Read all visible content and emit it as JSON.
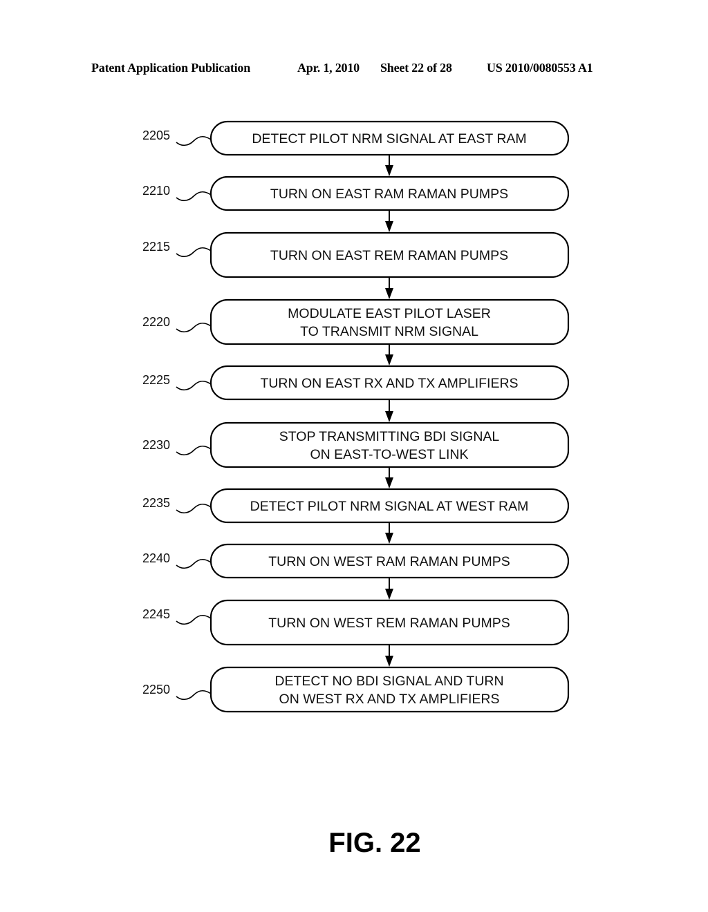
{
  "header": {
    "publication": "Patent Application Publication",
    "date": "Apr. 1, 2010",
    "sheet": "Sheet 22 of 28",
    "number": "US 2010/0080553 A1"
  },
  "steps": [
    {
      "ref": "2205",
      "lines": [
        "DETECT PILOT NRM SIGNAL AT EAST RAM"
      ]
    },
    {
      "ref": "2210",
      "lines": [
        "TURN ON EAST RAM RAMAN PUMPS"
      ]
    },
    {
      "ref": "2215",
      "lines": [
        "TURN ON EAST REM RAMAN PUMPS"
      ]
    },
    {
      "ref": "2220",
      "lines": [
        "MODULATE EAST PILOT LASER",
        "TO TRANSMIT NRM SIGNAL"
      ]
    },
    {
      "ref": "2225",
      "lines": [
        "TURN ON EAST RX AND TX AMPLIFIERS"
      ]
    },
    {
      "ref": "2230",
      "lines": [
        "STOP TRANSMITTING BDI SIGNAL",
        "ON EAST-TO-WEST LINK"
      ]
    },
    {
      "ref": "2235",
      "lines": [
        "DETECT PILOT NRM SIGNAL AT WEST RAM"
      ]
    },
    {
      "ref": "2240",
      "lines": [
        "TURN ON WEST RAM RAMAN PUMPS"
      ]
    },
    {
      "ref": "2245",
      "lines": [
        "TURN ON WEST REM RAMAN PUMPS"
      ]
    },
    {
      "ref": "2250",
      "lines": [
        "DETECT NO BDI SIGNAL AND TURN",
        "ON WEST RX AND TX AMPLIFIERS"
      ]
    }
  ],
  "figure_label": "FIG. 22"
}
